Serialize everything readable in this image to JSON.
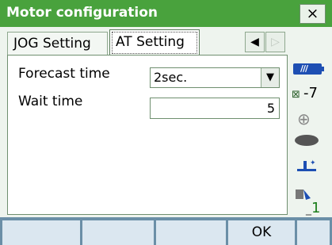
{
  "window": {
    "title": "Motor configuration",
    "close_label": "×"
  },
  "tabs": [
    {
      "label": "JOG Setting"
    },
    {
      "label": "AT Setting"
    }
  ],
  "nav": {
    "left": "◀",
    "right": "▷"
  },
  "form": {
    "forecast_time": {
      "label": "Forecast time",
      "value": "2sec.",
      "dropdown_icon": "▼"
    },
    "wait_time": {
      "label": "Wait time",
      "value": "5"
    }
  },
  "status": {
    "battery_marks": "///",
    "tilt_value": "-7",
    "input_mode_underscore": "_",
    "input_mode_value": "1"
  },
  "softkeys": [
    "",
    "",
    "",
    "OK",
    ""
  ],
  "colors": {
    "titlebar": "#49a23d",
    "softkey_bar": "#6b8fa7"
  }
}
